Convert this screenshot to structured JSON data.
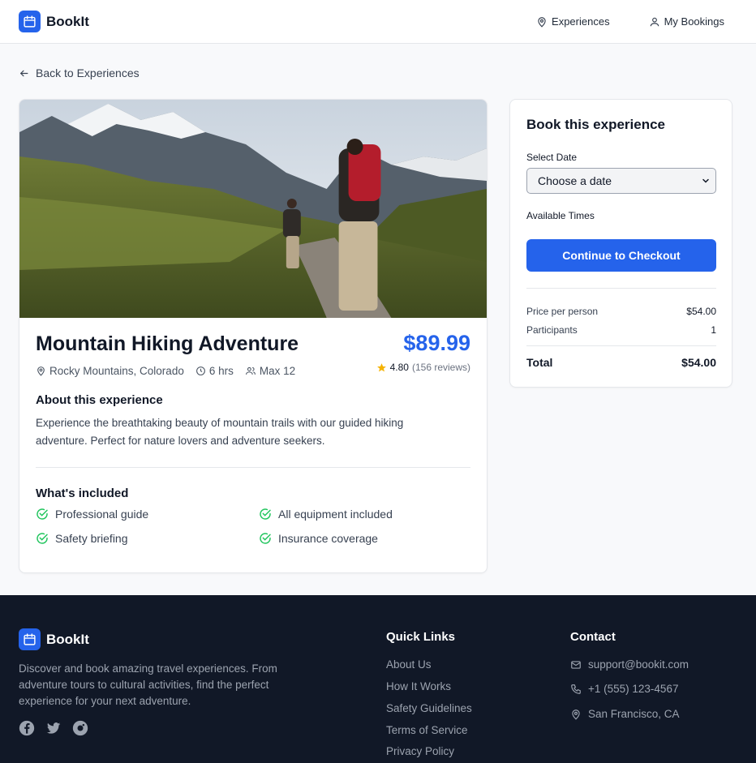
{
  "brand": {
    "name": "BookIt",
    "accent": "#2563eb"
  },
  "nav": {
    "experiences": "Experiences",
    "bookings": "My Bookings"
  },
  "back_label": "Back to Experiences",
  "experience": {
    "title": "Mountain Hiking Adventure",
    "price": "$89.99",
    "location": "Rocky Mountains, Colorado",
    "duration": "6 hrs",
    "capacity": "Max 12",
    "rating": "4.80",
    "reviews": "(156 reviews)",
    "about_heading": "About this experience",
    "description": "Experience the breathtaking beauty of mountain trails with our guided hiking adventure. Perfect for nature lovers and adventure seekers.",
    "included_heading": "What's included",
    "included": [
      "Professional guide",
      "All equipment included",
      "Safety briefing",
      "Insurance coverage"
    ]
  },
  "booking": {
    "title": "Book this experience",
    "date_label": "Select Date",
    "date_value": "Choose a date",
    "times_label": "Available Times",
    "button": "Continue to Checkout",
    "price_label": "Price per person",
    "price_value": "$54.00",
    "participants_label": "Participants",
    "participants_value": "1",
    "total_label": "Total",
    "total_value": "$54.00"
  },
  "footer": {
    "brand": "BookIt",
    "description": "Discover and book amazing travel experiences. From adventure tours to cultural activities, find the perfect experience for your next adventure.",
    "quick_links_heading": "Quick Links",
    "links": [
      "About Us",
      "How It Works",
      "Safety Guidelines",
      "Terms of Service",
      "Privacy Policy"
    ],
    "contact_heading": "Contact",
    "email": "support@bookit.com",
    "phone": "+1 (555) 123-4567",
    "address": "San Francisco, CA"
  }
}
